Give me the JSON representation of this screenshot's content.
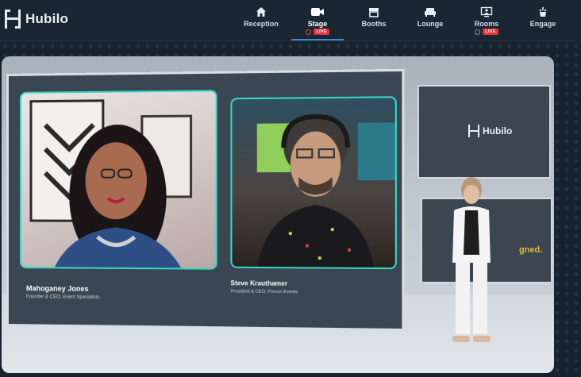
{
  "app": {
    "name": "Hubilo"
  },
  "nav": {
    "items": [
      {
        "label": "Reception",
        "icon": "home-icon"
      },
      {
        "label": "Stage",
        "icon": "video-camera-icon",
        "live": "LIVE"
      },
      {
        "label": "Booths",
        "icon": "booth-icon"
      },
      {
        "label": "Lounge",
        "icon": "lounge-icon"
      },
      {
        "label": "Rooms",
        "icon": "rooms-icon",
        "live": "LIVE"
      },
      {
        "label": "Engage",
        "icon": "engage-icon"
      }
    ]
  },
  "stage": {
    "speakers": [
      {
        "name": "Mahoganey Jones",
        "title": "Founder & CEO, Event Specialists"
      },
      {
        "name": "Steve Krauthamer",
        "title": "President & CEO, Precon Events"
      }
    ],
    "side_logo": "Hubilo",
    "side_partial_text": "gned."
  },
  "colors": {
    "accent_teal": "#37d6c4",
    "live_red": "#e0353d",
    "active_underline": "#3b8bd6"
  }
}
